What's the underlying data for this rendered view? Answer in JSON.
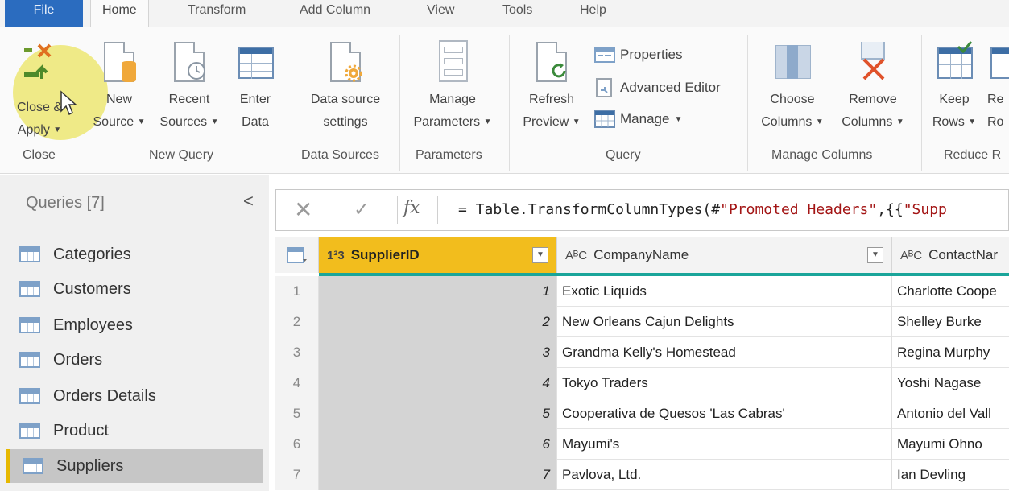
{
  "ribbon_tabs": [
    "File",
    "Home",
    "Transform",
    "Add Column",
    "View",
    "Tools",
    "Help"
  ],
  "ribbon": {
    "close_apply": [
      "Close &",
      "Apply"
    ],
    "new_source": [
      "New",
      "Source"
    ],
    "recent_sources": [
      "Recent",
      "Sources"
    ],
    "enter_data": [
      "Enter",
      "Data"
    ],
    "data_source_settings": [
      "Data source",
      "settings"
    ],
    "manage_parameters": [
      "Manage",
      "Parameters"
    ],
    "refresh_preview": [
      "Refresh",
      "Preview"
    ],
    "properties": "Properties",
    "advanced_editor": "Advanced Editor",
    "manage": "Manage",
    "choose_columns": [
      "Choose",
      "Columns"
    ],
    "remove_columns": [
      "Remove",
      "Columns"
    ],
    "keep_rows": [
      "Keep",
      "Rows"
    ],
    "reduce_rows_partial": [
      "Re",
      "Ro"
    ],
    "groups": {
      "close": "Close",
      "new_query": "New Query",
      "data_sources": "Data Sources",
      "parameters": "Parameters",
      "query": "Query",
      "manage_columns": "Manage Columns",
      "reduce_rows": "Reduce R"
    }
  },
  "sidebar": {
    "title": "Queries [7]",
    "collapse_glyph": "<",
    "items": [
      "Categories",
      "Customers",
      "Employees",
      "Orders",
      "Orders Details",
      "Product",
      "Suppliers"
    ],
    "active_item": "Suppliers"
  },
  "formula_bar": {
    "cancel_glyph": "✕",
    "confirm_glyph": "✓",
    "fx_label": "fx",
    "expression_prefix": "= Table.TransformColumnTypes(#",
    "expression_str1": "\"Promoted Headers\"",
    "expression_mid": ",{{",
    "expression_str2": "\"Supp"
  },
  "grid": {
    "columns": [
      {
        "type_glyph": "1²3",
        "name": "SupplierID"
      },
      {
        "type_glyph": "AᴮC",
        "name": "CompanyName"
      },
      {
        "type_glyph": "AᴮC",
        "name": "ContactNar"
      }
    ],
    "rows": [
      {
        "index": "1",
        "supplier_id": "1",
        "company": "Exotic Liquids",
        "contact": "Charlotte Coope"
      },
      {
        "index": "2",
        "supplier_id": "2",
        "company": "New Orleans Cajun Delights",
        "contact": "Shelley Burke"
      },
      {
        "index": "3",
        "supplier_id": "3",
        "company": "Grandma Kelly's Homestead",
        "contact": "Regina Murphy"
      },
      {
        "index": "4",
        "supplier_id": "4",
        "company": "Tokyo Traders",
        "contact": "Yoshi Nagase"
      },
      {
        "index": "5",
        "supplier_id": "5",
        "company": "Cooperativa de Quesos 'Las Cabras'",
        "contact": "Antonio del Vall"
      },
      {
        "index": "6",
        "supplier_id": "6",
        "company": "Mayumi's",
        "contact": "Mayumi Ohno"
      },
      {
        "index": "7",
        "supplier_id": "7",
        "company": "Pavlova, Ltd.",
        "contact": "Ian Devling"
      }
    ]
  },
  "colors": {
    "accent_blue": "#2b6cbf",
    "selected_header": "#f2bd1d",
    "column_quality": "#1aa59a",
    "highlight": "#e6dc28"
  }
}
